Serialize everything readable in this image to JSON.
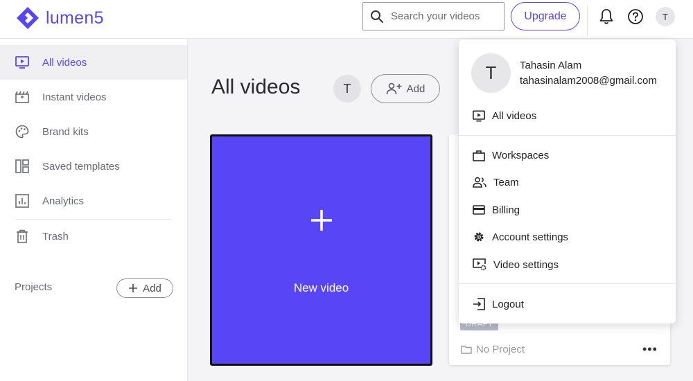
{
  "header": {
    "logo_text": "lumen5",
    "search_placeholder": "Search your videos",
    "upgrade_label": "Upgrade",
    "avatar_initial": "T",
    "brand_color": "#5846f6"
  },
  "sidebar": {
    "items": [
      {
        "label": "All videos",
        "icon": "play-screen-icon",
        "active": true
      },
      {
        "label": "Instant videos",
        "icon": "clapperboard-icon",
        "active": false
      },
      {
        "label": "Brand kits",
        "icon": "palette-icon",
        "active": false
      },
      {
        "label": "Saved templates",
        "icon": "template-icon",
        "active": false
      },
      {
        "label": "Analytics",
        "icon": "analytics-icon",
        "active": false
      },
      {
        "label": "Trash",
        "icon": "trash-icon",
        "active": false
      }
    ],
    "projects_label": "Projects",
    "projects_add_label": "Add"
  },
  "main": {
    "title": "All videos",
    "member_initial": "T",
    "add_member_label": "Add",
    "new_video_label": "New video",
    "card": {
      "status_badge": "DRAFT",
      "project_label": "No Project",
      "more_label": "•••"
    }
  },
  "account_menu": {
    "avatar_initial": "T",
    "name": "Tahasin Alam",
    "email": "tahasinalam2008@gmail.com",
    "items": [
      {
        "label": "All videos",
        "icon": "play-screen-icon"
      },
      {
        "label": "Workspaces",
        "icon": "briefcase-icon"
      },
      {
        "label": "Team",
        "icon": "team-icon"
      },
      {
        "label": "Billing",
        "icon": "credit-card-icon"
      },
      {
        "label": "Account settings",
        "icon": "gear-icon"
      },
      {
        "label": "Video settings",
        "icon": "video-settings-icon"
      },
      {
        "label": "Logout",
        "icon": "logout-icon"
      }
    ]
  }
}
